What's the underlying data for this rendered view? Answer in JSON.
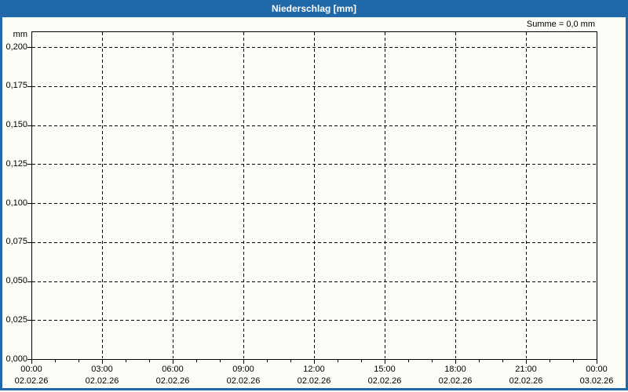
{
  "header": {
    "title": "Niederschlag [mm]"
  },
  "chart_data": {
    "type": "bar",
    "title": "Niederschlag [mm]",
    "xlabel": "",
    "ylabel": "mm",
    "annotation": "Summe = 0,0 mm",
    "sum_value_mm": "0,0",
    "ylim": [
      0,
      0.21
    ],
    "grid": "dashed",
    "legend_position": "none",
    "y_ticks": [
      "0,000",
      "0,025",
      "0,050",
      "0,075",
      "0,100",
      "0,125",
      "0,150",
      "0,175",
      "0,200"
    ],
    "x_ticks": [
      {
        "time": "00:00",
        "date": "02.02.26"
      },
      {
        "time": "03:00",
        "date": "02.02.26"
      },
      {
        "time": "06:00",
        "date": "02.02.26"
      },
      {
        "time": "09:00",
        "date": "02.02.26"
      },
      {
        "time": "12:00",
        "date": "02.02.26"
      },
      {
        "time": "15:00",
        "date": "02.02.26"
      },
      {
        "time": "18:00",
        "date": "02.02.26"
      },
      {
        "time": "21:00",
        "date": "02.02.26"
      },
      {
        "time": "00:00",
        "date": "03.02.26"
      }
    ],
    "minor_ticks_per_major_interval": 2,
    "series": [
      {
        "name": "Niederschlag",
        "values": []
      }
    ],
    "colors": {
      "titlebar": "#2069a8",
      "window_border": "#2069a8",
      "title_text": "#ffffff",
      "grid": "#000000",
      "axis_text": "#000000",
      "background": "#fdfdf7"
    }
  }
}
